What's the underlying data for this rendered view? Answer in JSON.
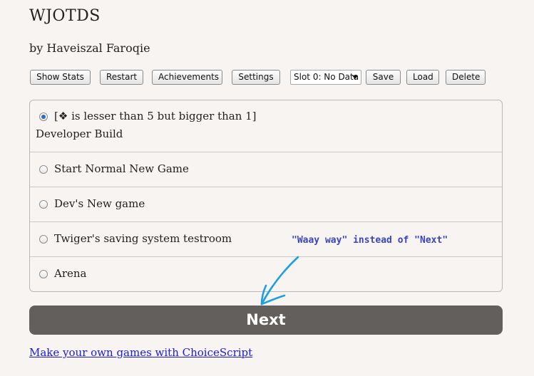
{
  "game": {
    "title": "WJOTDS",
    "byline": "by Haveiszal Faroqie"
  },
  "toolbar": {
    "show_stats": "Show Stats",
    "restart": "Restart",
    "achievements": "Achievements",
    "settings": "Settings",
    "slot_selected": "Slot 0: No Data",
    "save": "Save",
    "load": "Load",
    "delete": "Delete"
  },
  "choices": [
    {
      "label": "[❖ is lesser than 5 but bigger than 1]",
      "sublabel": "Developer Build",
      "selected": true
    },
    {
      "label": "Start Normal New Game",
      "selected": false
    },
    {
      "label": "Dev's New game",
      "selected": false
    },
    {
      "label": "Twiger's saving system testroom",
      "selected": false
    },
    {
      "label": "Arena",
      "selected": false
    }
  ],
  "next_button": "Next",
  "footer_link": "Make your own games with ChoiceScript",
  "annotation": {
    "text": "\"Waay way\" instead of \"Next\"",
    "color": "#3a44c6",
    "arrow_color": "#1f9fe0"
  },
  "colors": {
    "background": "#f7f4f1",
    "next_button_bg": "#625f5c",
    "link": "#1a1aee",
    "radio_selected": "#2c6fbb"
  }
}
